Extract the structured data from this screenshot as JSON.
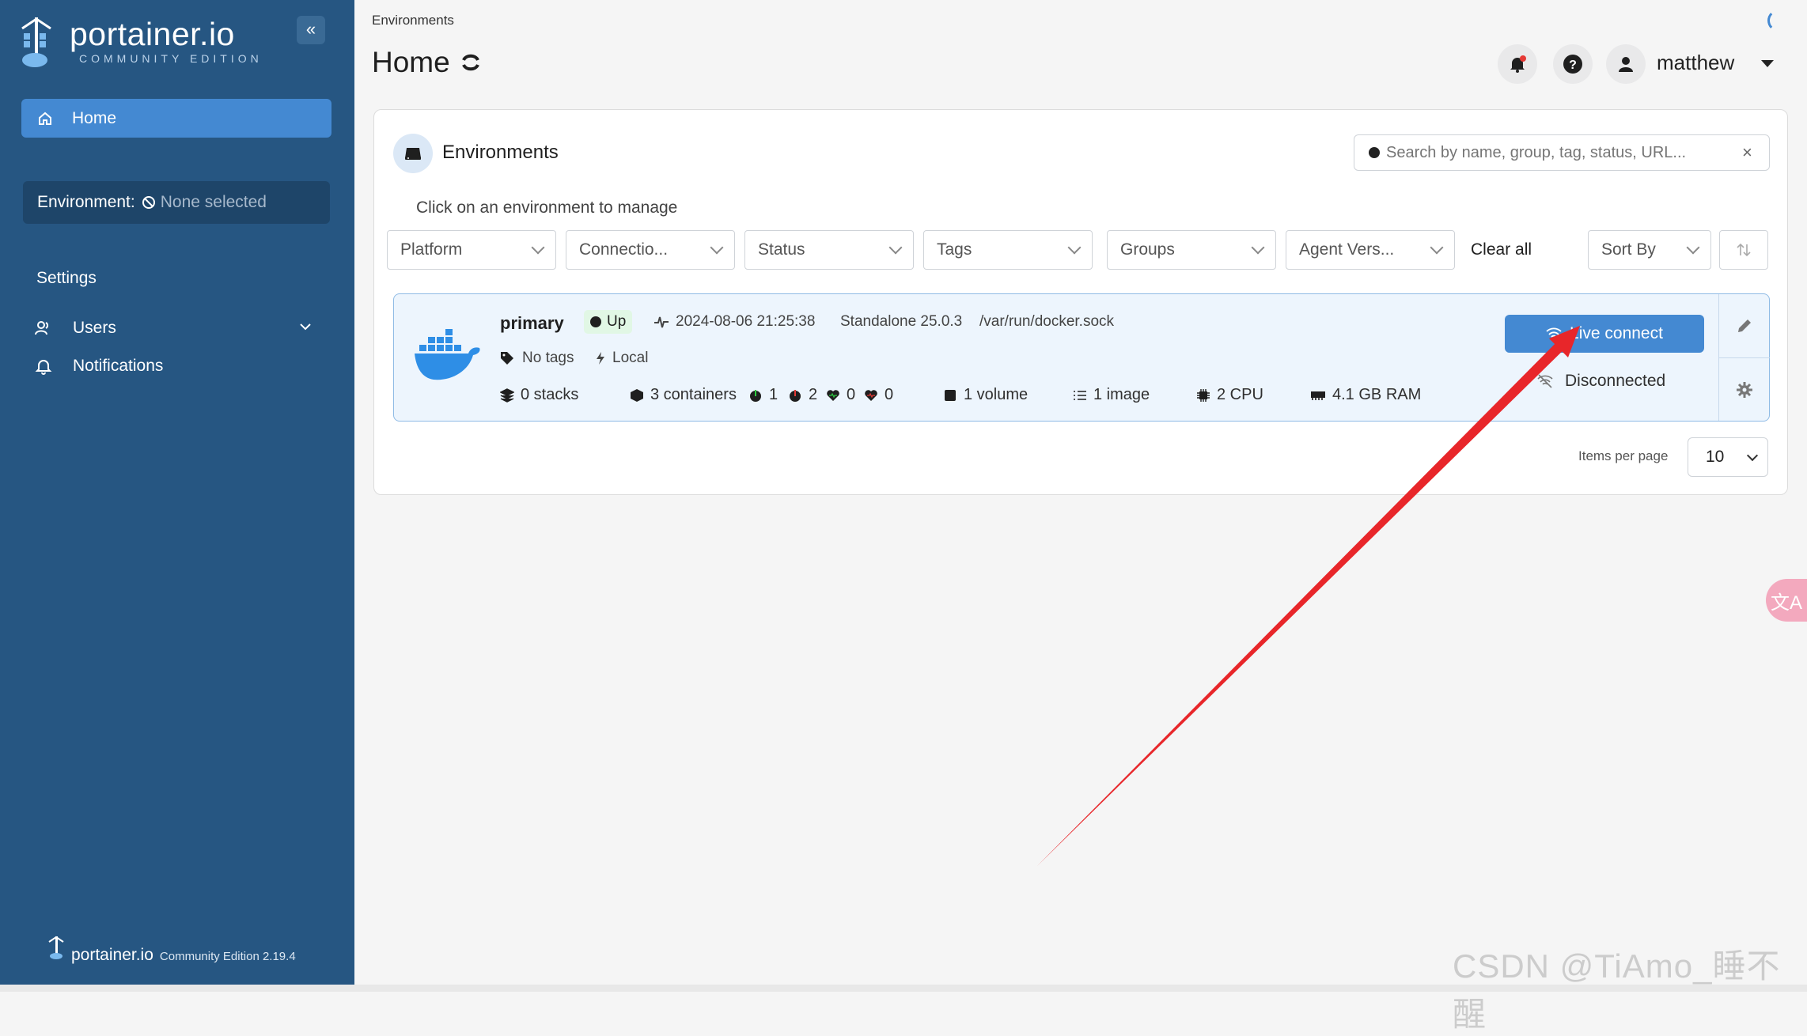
{
  "app": {
    "logo_text": "portainer.io",
    "logo_sub": "COMMUNITY EDITION",
    "collapse_glyph": "«"
  },
  "sidebar": {
    "home_label": "Home",
    "environment_key": "Environment:",
    "environment_value": "None selected",
    "settings_heading": "Settings",
    "items": [
      {
        "label": "Users",
        "icon": "users-icon"
      },
      {
        "label": "Notifications",
        "icon": "bell-icon"
      }
    ],
    "footer_brand": "portainer.io",
    "footer_edition": "Community Edition 2.19.4"
  },
  "header": {
    "breadcrumb": "Environments",
    "title": "Home",
    "username": "matthew"
  },
  "environments": {
    "title": "Environments",
    "search_placeholder": "Search by name, group, tag, status, URL...",
    "hint": "Click on an environment to manage",
    "filters": [
      "Platform",
      "Connectio...",
      "Status",
      "Tags",
      "Groups",
      "Agent Vers..."
    ],
    "clear_all": "Clear all",
    "sort_by": "Sort By",
    "items_per_page_label": "Items per page",
    "items_per_page_value": "10"
  },
  "env_card": {
    "name": "primary",
    "status": "Up",
    "timestamp": "2024-08-06 21:25:38",
    "type": "Standalone 25.0.3",
    "socket": "/var/run/docker.sock",
    "tags": "No tags",
    "location": "Local",
    "stacks": "0 stacks",
    "containers": "3 containers",
    "running": "1",
    "stopped": "2",
    "healthy": "0",
    "unhealthy": "0",
    "volumes": "1 volume",
    "images": "1 image",
    "cpu": "2 CPU",
    "ram": "4.1 GB RAM",
    "live_connect": "Live connect",
    "disconnected": "Disconnected"
  },
  "overlay": {
    "watermark": "CSDN @TiAmo_睡不醒",
    "translate_glyph": "文A",
    "annotation_color": "#e8262a"
  }
}
